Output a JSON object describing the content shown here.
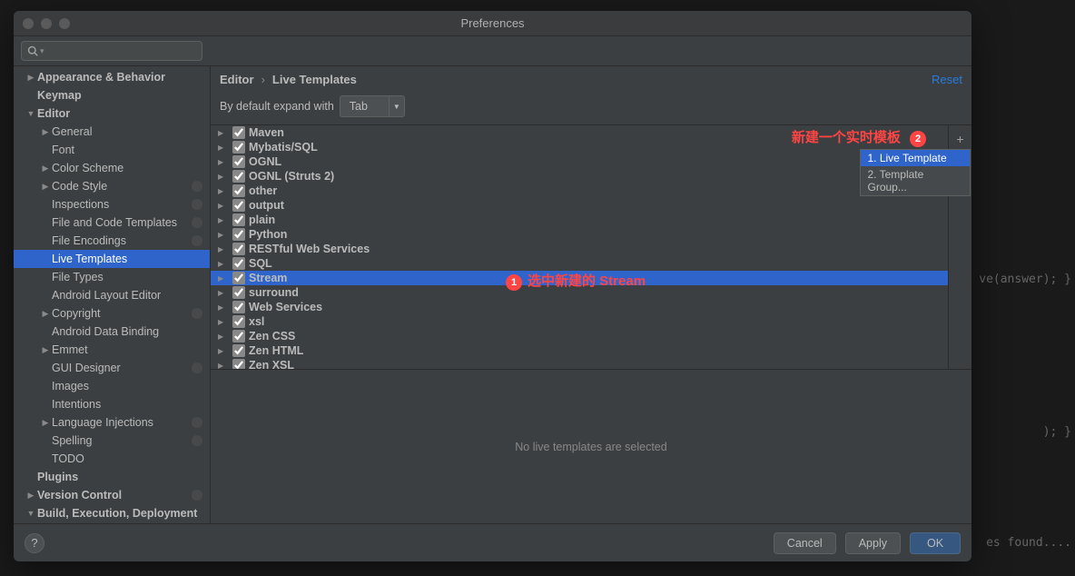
{
  "window_title": "Preferences",
  "search_placeholder": "",
  "breadcrumb": {
    "parent": "Editor",
    "current": "Live Templates"
  },
  "reset_label": "Reset",
  "expand_label": "By default expand with",
  "expand_value": "Tab",
  "sidebar": {
    "items": [
      {
        "label": "Appearance & Behavior",
        "indent": 0,
        "arrow": "right",
        "bold": true
      },
      {
        "label": "Keymap",
        "indent": 0,
        "bold": true
      },
      {
        "label": "Editor",
        "indent": 0,
        "arrow": "down",
        "bold": true
      },
      {
        "label": "General",
        "indent": 1,
        "arrow": "right"
      },
      {
        "label": "Font",
        "indent": 1
      },
      {
        "label": "Color Scheme",
        "indent": 1,
        "arrow": "right"
      },
      {
        "label": "Code Style",
        "indent": 1,
        "arrow": "right",
        "badge": true
      },
      {
        "label": "Inspections",
        "indent": 1,
        "badge": true
      },
      {
        "label": "File and Code Templates",
        "indent": 1,
        "badge": true
      },
      {
        "label": "File Encodings",
        "indent": 1,
        "badge": true
      },
      {
        "label": "Live Templates",
        "indent": 1,
        "selected": true
      },
      {
        "label": "File Types",
        "indent": 1
      },
      {
        "label": "Android Layout Editor",
        "indent": 1
      },
      {
        "label": "Copyright",
        "indent": 1,
        "arrow": "right",
        "badge": true
      },
      {
        "label": "Android Data Binding",
        "indent": 1
      },
      {
        "label": "Emmet",
        "indent": 1,
        "arrow": "right"
      },
      {
        "label": "GUI Designer",
        "indent": 1,
        "badge": true
      },
      {
        "label": "Images",
        "indent": 1
      },
      {
        "label": "Intentions",
        "indent": 1
      },
      {
        "label": "Language Injections",
        "indent": 1,
        "arrow": "right",
        "badge": true
      },
      {
        "label": "Spelling",
        "indent": 1,
        "badge": true
      },
      {
        "label": "TODO",
        "indent": 1
      },
      {
        "label": "Plugins",
        "indent": 0,
        "bold": true
      },
      {
        "label": "Version Control",
        "indent": 0,
        "arrow": "right",
        "bold": true,
        "badge": true
      },
      {
        "label": "Build, Execution, Deployment",
        "indent": 0,
        "arrow": "down",
        "bold": true
      }
    ]
  },
  "templates": [
    {
      "label": "Maven",
      "checked": true
    },
    {
      "label": "Mybatis/SQL",
      "checked": true
    },
    {
      "label": "OGNL",
      "checked": true
    },
    {
      "label": "OGNL (Struts 2)",
      "checked": true
    },
    {
      "label": "other",
      "checked": true
    },
    {
      "label": "output",
      "checked": true
    },
    {
      "label": "plain",
      "checked": true
    },
    {
      "label": "Python",
      "checked": true
    },
    {
      "label": "RESTful Web Services",
      "checked": true
    },
    {
      "label": "SQL",
      "checked": true
    },
    {
      "label": "Stream",
      "checked": true,
      "selected": true
    },
    {
      "label": "surround",
      "checked": true
    },
    {
      "label": "Web Services",
      "checked": true
    },
    {
      "label": "xsl",
      "checked": true
    },
    {
      "label": "Zen CSS",
      "checked": true
    },
    {
      "label": "Zen HTML",
      "checked": true
    },
    {
      "label": "Zen XSL",
      "checked": true
    }
  ],
  "popup": {
    "item1": "1. Live Template",
    "item2": "2. Template Group..."
  },
  "detail_msg": "No live templates are selected",
  "buttons": {
    "cancel": "Cancel",
    "apply": "Apply",
    "ok": "OK"
  },
  "annotations": {
    "anno1_badge": "1",
    "anno1_text": "选中新建的 Stream",
    "anno2_badge": "2",
    "anno2_text": "新建一个实时模板"
  },
  "code_bg": {
    "line1": "ve(answer); }",
    "line2": "); }",
    "line3": "es found...."
  }
}
